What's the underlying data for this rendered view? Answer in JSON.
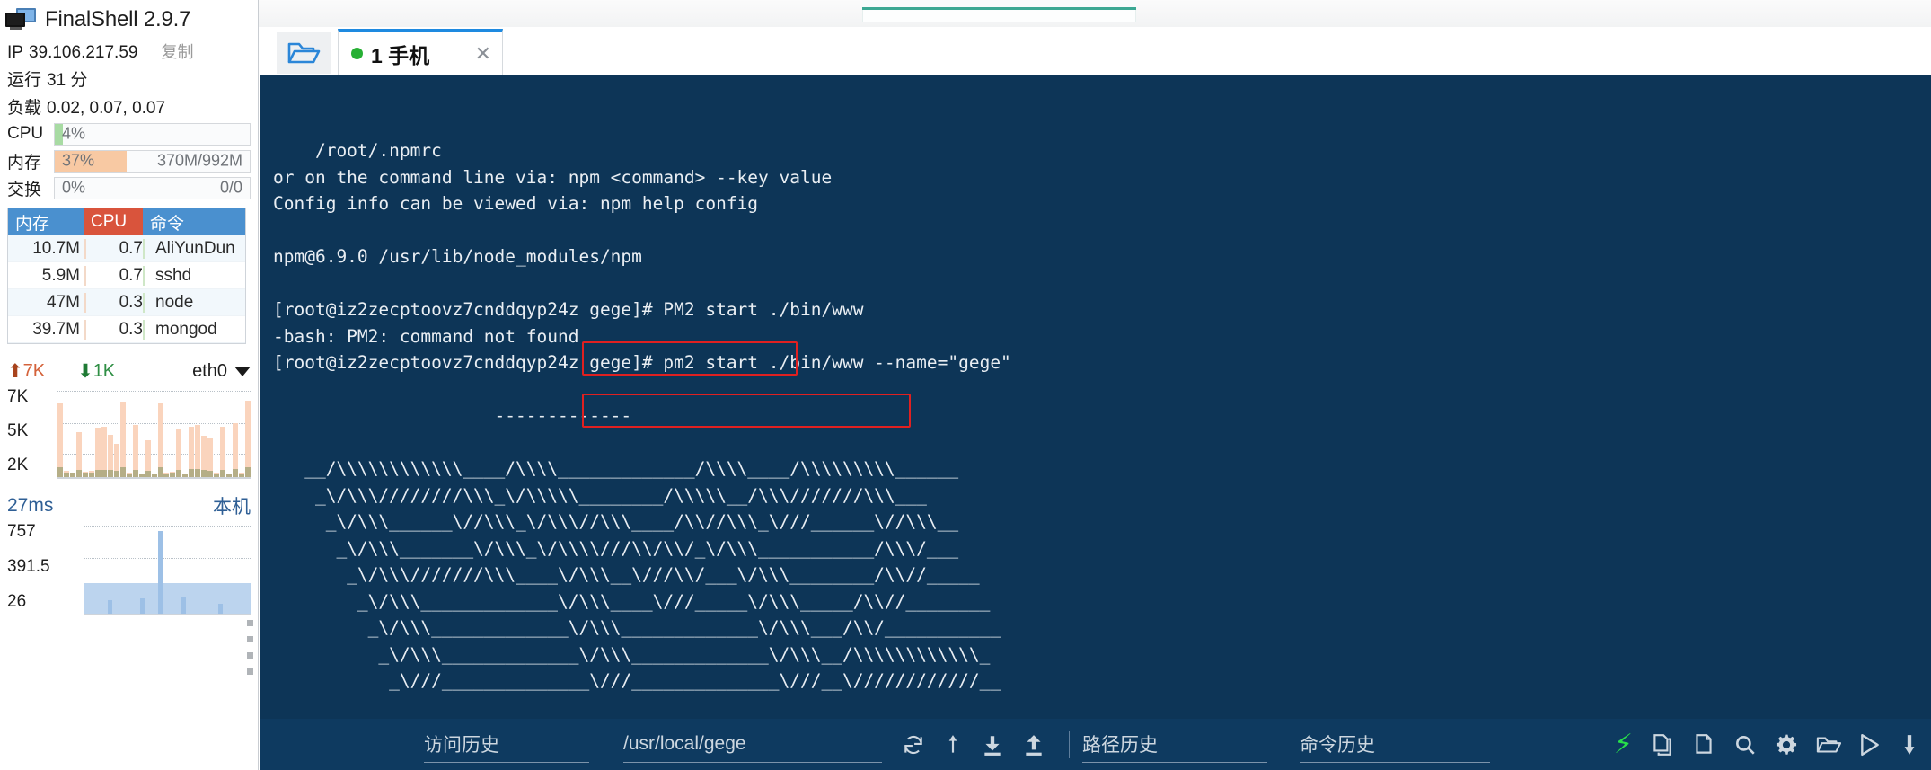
{
  "app": {
    "title": "FinalShell 2.9.7",
    "icon": "monitor-icon"
  },
  "sidebar": {
    "ip_label": "IP",
    "ip_value": "39.106.217.59",
    "copy_label": "复制",
    "uptime_label": "运行",
    "uptime_value": "31 分",
    "load_label": "负载",
    "load_value": "0.02, 0.07, 0.07",
    "meters": [
      {
        "name": "cpu",
        "label": "CPU",
        "percent": "4%",
        "right": "",
        "fill_pct": 4,
        "fill_color": "#a8dba3"
      },
      {
        "name": "memory",
        "label": "内存",
        "percent": "37%",
        "right": "370M/992M",
        "fill_pct": 37,
        "fill_color": "#f8c9a3"
      },
      {
        "name": "swap",
        "label": "交换",
        "percent": "0%",
        "right": "0/0",
        "fill_pct": 0,
        "fill_color": "#cccccc"
      }
    ],
    "process_table": {
      "columns": [
        "内存",
        "CPU",
        "命令"
      ],
      "rows": [
        {
          "mem": "10.7M",
          "cpu": "0.7",
          "cmd": "AliYunDun"
        },
        {
          "mem": "5.9M",
          "cpu": "0.7",
          "cmd": "sshd"
        },
        {
          "mem": "47M",
          "cpu": "0.3",
          "cmd": "node"
        },
        {
          "mem": "39.7M",
          "cpu": "0.3",
          "cmd": "mongod"
        }
      ]
    },
    "network": {
      "upload": "7K",
      "download": "1K",
      "interface": "eth0",
      "up_icon": "arrow-up-icon",
      "down_icon": "arrow-down-icon",
      "dropdown_icon": "chevron-down-icon"
    },
    "ping": {
      "latency": "27ms",
      "target": "本机"
    }
  },
  "chart_data": [
    {
      "type": "bar",
      "name": "network-traffic",
      "title": "",
      "ylabel": "",
      "xlabel": "",
      "yticks": [
        "7K",
        "5K",
        "2K"
      ],
      "ylim": [
        0,
        8000
      ],
      "grid": true,
      "legend": [
        "upload",
        "download"
      ],
      "series": [
        {
          "name": "upload",
          "color": "#fad4bd",
          "values": [
            6800,
            600,
            400,
            4200,
            500,
            600,
            4600,
            4700,
            3900,
            3100,
            7000,
            400,
            4800,
            300,
            3400,
            350,
            6900,
            400,
            500,
            4500,
            350,
            4700,
            4800,
            3800,
            3600,
            400,
            4700,
            350,
            5000,
            400,
            7100
          ]
        },
        {
          "name": "download",
          "color": "#b5ae87",
          "values": [
            900,
            450,
            380,
            700,
            420,
            430,
            700,
            690,
            640,
            600,
            900,
            370,
            700,
            330,
            620,
            340,
            880,
            360,
            400,
            700,
            330,
            720,
            730,
            640,
            620,
            360,
            700,
            330,
            740,
            360,
            920
          ]
        }
      ]
    },
    {
      "type": "area",
      "name": "ping-latency",
      "title": "",
      "yticks": [
        "757",
        "391.5",
        "26"
      ],
      "ylim": [
        0,
        757
      ],
      "grid": true,
      "values": [
        26,
        26,
        26,
        26,
        26,
        120,
        26,
        26,
        26,
        26,
        26,
        26,
        140,
        26,
        26,
        26,
        757,
        26,
        26,
        26,
        26,
        150,
        26,
        26,
        26,
        26,
        26,
        26,
        26,
        90,
        26,
        26,
        26,
        26,
        26,
        26
      ]
    }
  ],
  "tabbar": {
    "folder_icon": "open-folder-icon",
    "tabs": [
      {
        "status_icon": "status-dot-icon",
        "label": "1 手机",
        "close_icon": "close-icon"
      }
    ]
  },
  "terminal": {
    "background": "#0d3557",
    "lines": [
      "    /root/.npmrc",
      "or on the command line via: npm <command> --key value",
      "Config info can be viewed via: npm help config",
      "",
      "npm@6.9.0 /usr/lib/node_modules/npm",
      "",
      "[root@iz2zecptoovz7cnddqyp24z gege]# PM2 start ./bin/www",
      "-bash: PM2: command not found",
      "[root@iz2zecptoovz7cnddqyp24z gege]# pm2 start ./bin/www --name=\"gege\"",
      "",
      "                     -------------",
      "",
      "   __/\\\\\\\\\\\\\\\\\\\\\\\\____/\\\\\\\\_____________/\\\\\\\\____/\\\\\\\\\\\\\\\\\\______",
      "    _\\/\\\\\\////////\\\\\\_\\/\\\\\\\\\\________/\\\\\\\\\\__/\\\\\\///////\\\\\\___",
      "     _\\/\\\\\\______\\//\\\\\\_\\/\\\\\\//\\\\\\____/\\\\//\\\\\\_\\///______\\//\\\\\\__",
      "      _\\/\\\\\\_______\\/\\\\\\_\\/\\\\\\\\///\\\\/\\\\/_\\/\\\\\\___________/\\\\\\/___",
      "       _\\/\\\\\\///////\\\\\\____\\/\\\\\\__\\///\\\\/___\\/\\\\\\________/\\\\//_____",
      "        _\\/\\\\\\_____________\\/\\\\\\____\\///_____\\/\\\\\\_____/\\\\//________",
      "         _\\/\\\\\\_____________\\/\\\\\\_____________\\/\\\\\\___/\\\\/___________",
      "          _\\/\\\\\\_____________\\/\\\\\\_____________\\/\\\\\\__/\\\\\\\\\\\\\\\\\\\\\\\\_",
      "           _\\///______________\\///______________\\///__\\////////////__"
    ],
    "highlight_boxes": [
      {
        "name": "pm2-uppercase-command",
        "text": "# PM2 start ./bin/www"
      },
      {
        "name": "pm2-lowercase-command",
        "text": "# pm2 start ./bin/www --name=\"gege\""
      }
    ]
  },
  "bottombar": {
    "visit_history_label": "访问历史",
    "path_value": "/usr/local/gege",
    "path_history_label": "路径历史",
    "command_history_label": "命令历史",
    "icons": [
      "refresh-icon",
      "upload-arrow-icon",
      "download-file-icon",
      "upload-file-icon",
      "bolt-icon",
      "copy-icon",
      "paste-icon",
      "search-icon",
      "gear-icon",
      "folder-icon",
      "play-icon",
      "download-icon"
    ]
  },
  "colors": {
    "terminal_bg": "#0d3557",
    "bottombar_bg": "#0e3a60",
    "tab_accent": "#1e8ae0",
    "highlight_red": "#e02020",
    "status_green": "#27b034",
    "cpu_header": "#d9543c",
    "mem_header": "#4a90cf"
  }
}
